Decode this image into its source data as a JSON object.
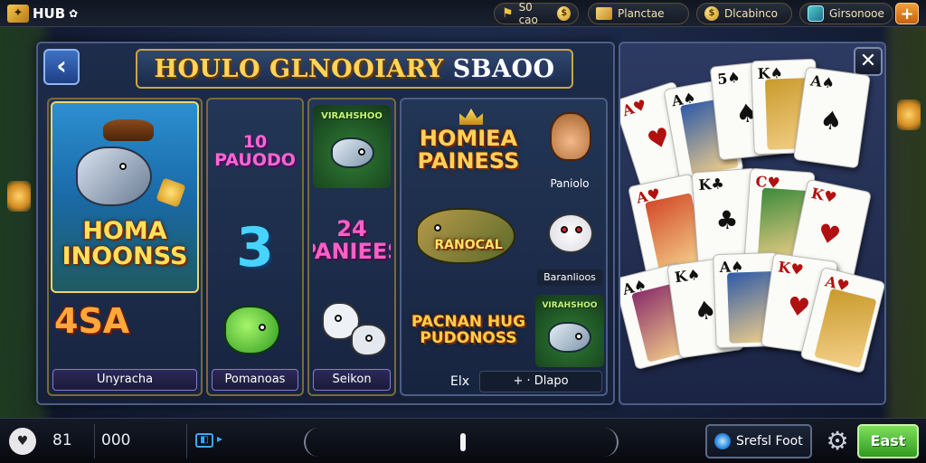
{
  "topbar": {
    "logo_text": "HUB",
    "logo_suffix": "✿",
    "currency_1": "S0 cao",
    "currency_2": "Planctae",
    "currency_3": "Dlcabinco",
    "currency_4": "Girsonooe",
    "add_label": "+"
  },
  "title": {
    "main": "HOULO GLNOOIARY",
    "sub": "SBAOO"
  },
  "nav": {
    "back_label": "‹",
    "close_label": "✕"
  },
  "tiles": {
    "featured_title": "HOMA INOONSS",
    "featured_badge": "4SA",
    "featured_label": "Unyracha",
    "col2_top": "10 PAUODO",
    "col2_mid": "3",
    "col2_label": "Pomanoas",
    "col3_top": "VIRAHSHOO",
    "col3_mid": "24 PANIEES",
    "col3_label": "Seikon",
    "col4_title": "HOMIEA PAINESS",
    "col4_char_label": "Paniolo",
    "col4_fish": "RANOCAL",
    "col4_rabbit_label": "Baranlioos",
    "col4_bottom": "PACNAN HUG PUDONOSS",
    "col4_fish2": "VIRAHSHOO",
    "col4_ribbon_left": "Elx",
    "col4_ribbon_right": "+ · Dlapo"
  },
  "cards": [
    {
      "rank": "A",
      "pip": "♥",
      "color": "red"
    },
    {
      "rank": "A",
      "pip": "♠",
      "color": "black"
    },
    {
      "rank": "5",
      "pip": "♠",
      "color": "black"
    },
    {
      "rank": "K",
      "pip": "♠",
      "color": "black"
    },
    {
      "rank": "A",
      "pip": "♠",
      "color": "black"
    },
    {
      "rank": "A",
      "pip": "♥",
      "color": "red"
    },
    {
      "rank": "K",
      "pip": "♣",
      "color": "black"
    },
    {
      "rank": "C",
      "pip": "♥",
      "color": "red"
    },
    {
      "rank": "K",
      "pip": "♥",
      "color": "red"
    },
    {
      "rank": "A",
      "pip": "♠",
      "color": "black"
    },
    {
      "rank": "K",
      "pip": "♠",
      "color": "black"
    },
    {
      "rank": "A",
      "pip": "♠",
      "color": "black"
    },
    {
      "rank": "K",
      "pip": "♥",
      "color": "red"
    },
    {
      "rank": "A",
      "pip": "♥",
      "color": "red"
    }
  ],
  "bottombar": {
    "heart_icon": "♥",
    "value_1": "81",
    "value_2": "000",
    "spin_label": "Srefsl Foot",
    "gear_icon": "⚙",
    "east_label": "East"
  }
}
